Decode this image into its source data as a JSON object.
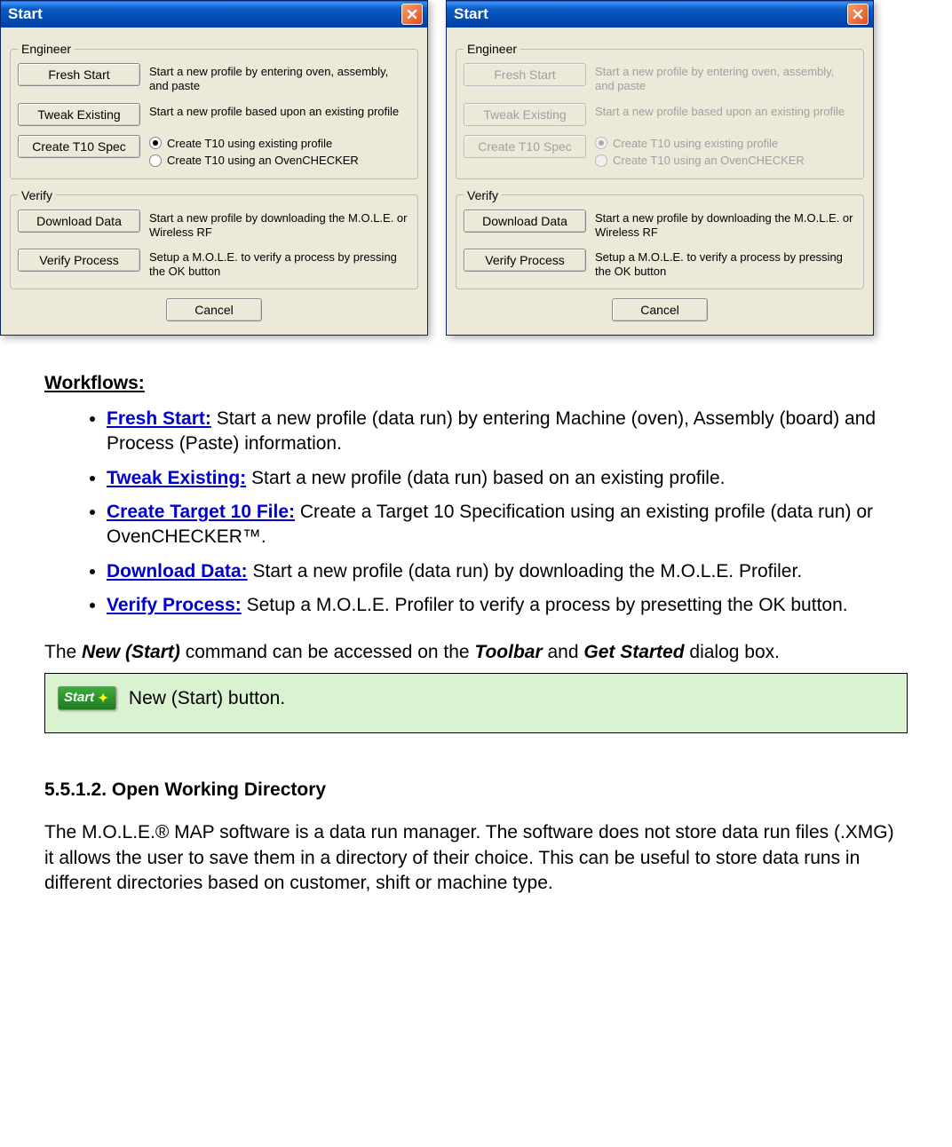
{
  "dialog": {
    "title": "Start",
    "engineer_legend": "Engineer",
    "verify_legend": "Verify",
    "buttons": {
      "fresh_start": "Fresh Start",
      "tweak_existing": "Tweak Existing",
      "create_t10": "Create T10 Spec",
      "download_data": "Download Data",
      "verify_process": "Verify Process",
      "cancel": "Cancel"
    },
    "descriptions": {
      "fresh_start": "Start a new profile by entering oven, assembly, and paste",
      "tweak_existing": "Start a new profile based upon an existing profile",
      "download_data": "Start a new profile by downloading the M.O.L.E. or Wireless RF",
      "verify_process": "Setup a M.O.L.E. to verify a process by pressing the OK button"
    },
    "radios": {
      "opt1": "Create T10 using existing profile",
      "opt2": "Create T10 using an OvenCHECKER"
    }
  },
  "doc": {
    "workflows_heading": "Workflows:",
    "items": [
      {
        "term": "Fresh Start:",
        "text": " Start a new profile (data run) by entering Machine (oven), Assembly (board) and Process (Paste) information."
      },
      {
        "term": "Tweak Existing:",
        "text": " Start a new profile (data run) based on an existing profile."
      },
      {
        "term": "Create Target 10 File:",
        "text": " Create a Target 10 Specification using an existing profile (data run) or OvenCHECKER™."
      },
      {
        "term": "Download Data:",
        "text": " Start a new profile (data run) by downloading the M.O.L.E. Profiler."
      },
      {
        "term": "Verify Process:",
        "text": " Setup a M.O.L.E. Profiler to verify a process by presetting the OK button."
      }
    ],
    "access_line_pre": "The ",
    "access_line_cmd": "New (Start)",
    "access_line_mid": " command can be accessed on the ",
    "access_line_toolbar": "Toolbar",
    "access_line_and": " and ",
    "access_line_getstarted": "Get Started",
    "access_line_post": " dialog box.",
    "badge_label": "Start",
    "note_text": "New (Start) button.",
    "section_heading": "5.5.1.2. Open Working Directory",
    "section_body": "The M.O.L.E.® MAP software is a data run manager. The software does not store data run files (.XMG) it allows the user to save them in a directory of their choice. This can be useful to store data runs in different directories based on customer, shift or machine type."
  }
}
